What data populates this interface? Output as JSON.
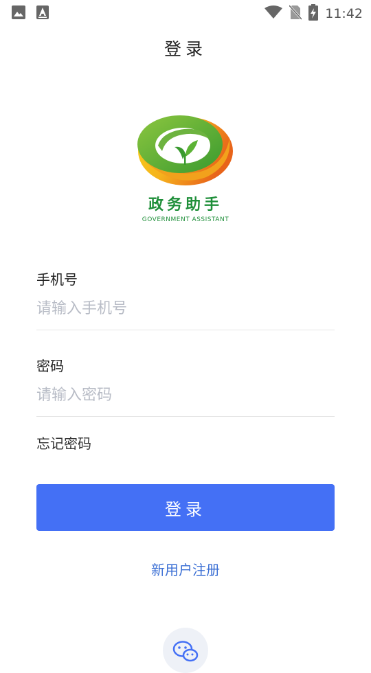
{
  "status_bar": {
    "time": "11:42",
    "icons": [
      "image-icon",
      "a-text-icon",
      "wifi-icon",
      "no-sim-icon",
      "battery-charging-icon"
    ]
  },
  "page": {
    "title": "登录"
  },
  "logo": {
    "name_cn": "政务助手",
    "name_en": "GOVERNMENT ASSISTANT"
  },
  "form": {
    "phone": {
      "label": "手机号",
      "placeholder": "请输入手机号",
      "value": ""
    },
    "password": {
      "label": "密码",
      "placeholder": "请输入密码",
      "value": ""
    },
    "forgot_label": "忘记密码",
    "login_label": "登录",
    "register_label": "新用户注册"
  },
  "social": {
    "wechat_icon": "wechat-icon"
  },
  "colors": {
    "primary": "#4470f5",
    "link": "#3b6fd4",
    "logo_green": "#1f8f3a",
    "logo_orange": "#f08a1c"
  }
}
